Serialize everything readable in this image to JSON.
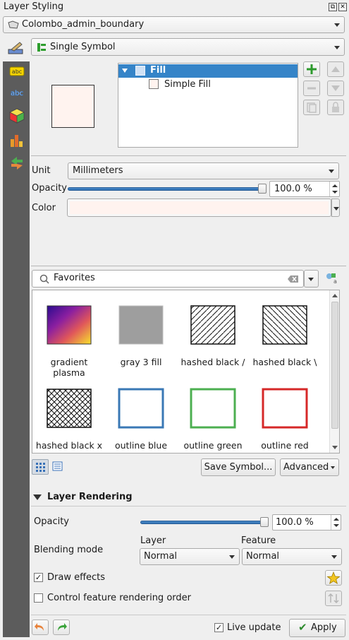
{
  "panel": {
    "title": "Layer Styling",
    "float_glyph": "⧉",
    "close_glyph": "✕"
  },
  "layer_combo": {
    "value": "Colombo_admin_boundary"
  },
  "renderer_combo": {
    "value": "Single Symbol"
  },
  "symbol_tree": {
    "root": "Fill",
    "child": "Simple Fill",
    "preview_color": "#fff3ef"
  },
  "unit": {
    "label": "Unit",
    "value": "Millimeters"
  },
  "opacity": {
    "label": "Opacity",
    "value": "100.0 %",
    "level": 1.0
  },
  "color": {
    "label": "Color",
    "value": "#fff3ef"
  },
  "search": {
    "value": "Favorites"
  },
  "library": {
    "symbols": [
      {
        "label": "gradient plasma",
        "kind": "gradient"
      },
      {
        "label": "gray 3 fill",
        "kind": "gray"
      },
      {
        "label": "hashed black /",
        "kind": "hash-fwd"
      },
      {
        "label": "hashed black \\",
        "kind": "hash-back"
      },
      {
        "label": "hashed black x",
        "kind": "hash-cross"
      },
      {
        "label": "outline blue",
        "kind": "outline",
        "color": "#3a78b5"
      },
      {
        "label": "outline green",
        "kind": "outline",
        "color": "#4caf50"
      },
      {
        "label": "outline red",
        "kind": "outline",
        "color": "#d62828"
      }
    ]
  },
  "buttons": {
    "save_symbol": "Save Symbol...",
    "advanced": "Advanced",
    "apply": "Apply"
  },
  "layer_rendering": {
    "title": "Layer Rendering",
    "opacity_label": "Opacity",
    "opacity_value": "100.0 %",
    "opacity_level": 1.0,
    "blending_label": "Blending mode",
    "layer_label": "Layer",
    "feature_label": "Feature",
    "layer_blend": "Normal",
    "feature_blend": "Normal",
    "draw_effects": "Draw effects",
    "control_order": "Control feature rendering order"
  },
  "footer": {
    "live_update": "Live update"
  },
  "icons": {
    "apply_check": "✔",
    "check": "✓"
  }
}
